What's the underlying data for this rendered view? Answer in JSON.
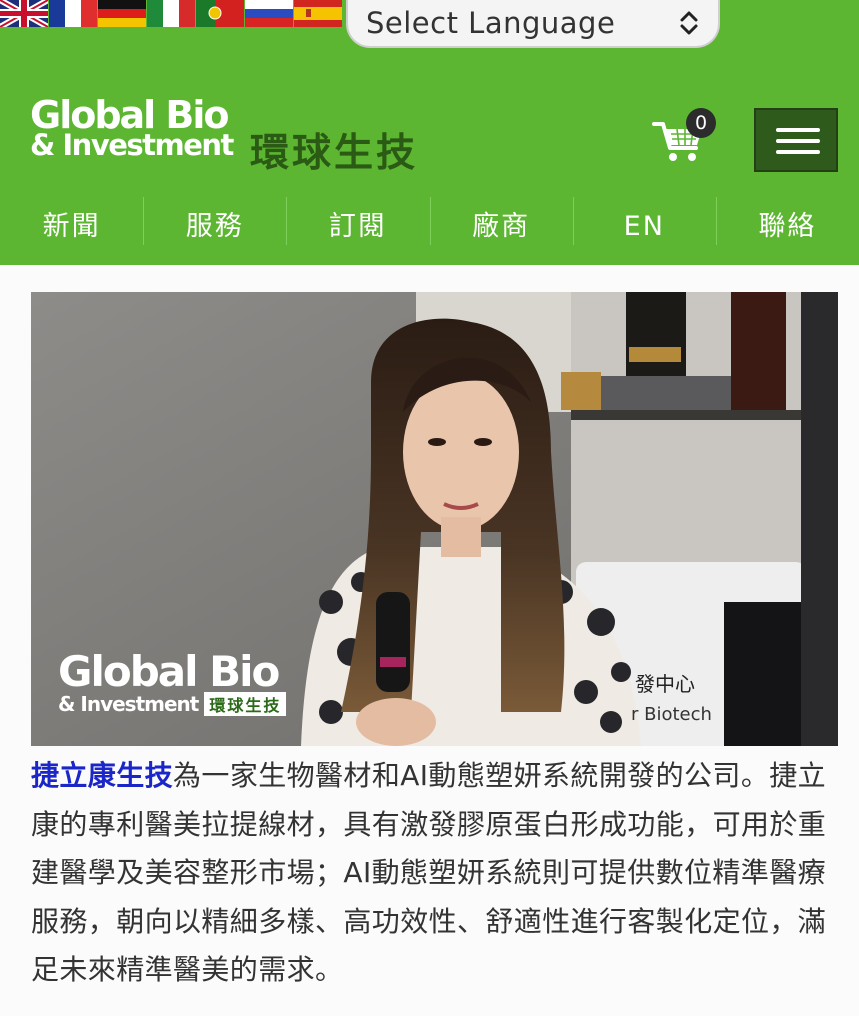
{
  "language_bar": {
    "flags": [
      {
        "name": "english-flag-icon",
        "lang": "English"
      },
      {
        "name": "french-flag-icon",
        "lang": "French"
      },
      {
        "name": "german-flag-icon",
        "lang": "German"
      },
      {
        "name": "italian-flag-icon",
        "lang": "Italian"
      },
      {
        "name": "portuguese-flag-icon",
        "lang": "Portuguese"
      },
      {
        "name": "russian-flag-icon",
        "lang": "Russian"
      },
      {
        "name": "spanish-flag-icon",
        "lang": "Spanish"
      }
    ],
    "select_label": "Select Language"
  },
  "header": {
    "logo_line1": "Global Bio",
    "logo_line2": "& Investment",
    "logo_zh": "環球生技",
    "cart_count": "0"
  },
  "nav": {
    "items": [
      "新聞",
      "服務",
      "訂閱",
      "廠商",
      "EN",
      "聯絡"
    ]
  },
  "photo": {
    "watermark_line1": "Global Bio",
    "watermark_line2": "& Investment",
    "watermark_zh": "環球生技",
    "sign_text": "發中心",
    "sign_text2": "r Biotech"
  },
  "article": {
    "link_text": "捷立康生技",
    "body": "為一家生物醫材和AI動態塑妍系統開發的公司。捷立康的專利醫美拉提線材，具有激發膠原蛋白形成功能，可用於重建醫學及美容整形市場；AI動態塑妍系統則可提供數位精準醫療服務，朝向以精細多樣、高功效性、舒適性進行客製化定位，滿足未來精準醫美的需求。"
  },
  "colors": {
    "brand_green": "#5cb632",
    "dark_green": "#2e5a1c",
    "link_blue": "#1b26c9"
  }
}
